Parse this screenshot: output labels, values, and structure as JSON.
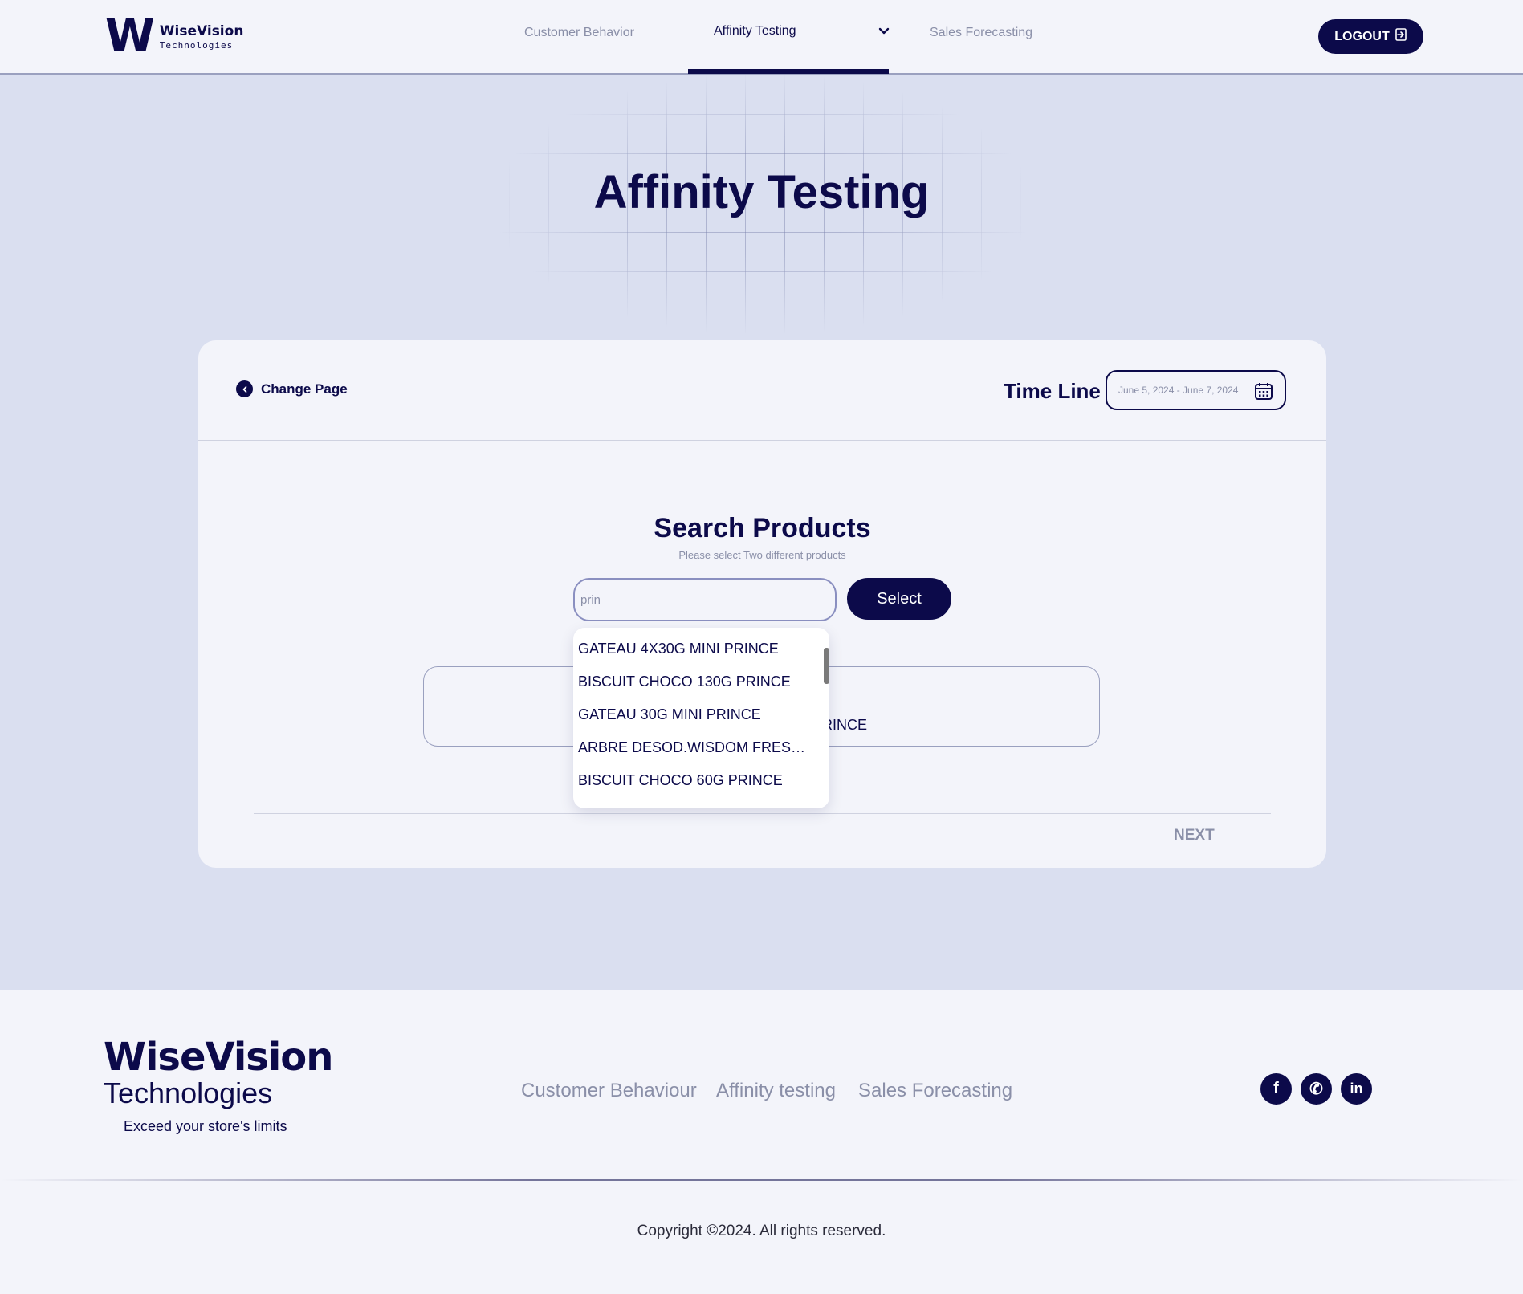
{
  "header": {
    "logo": {
      "mark": "W",
      "name": "WiseVision",
      "sub": "Technologies"
    },
    "nav": [
      {
        "label": "Customer Behavior"
      },
      {
        "label": "Affinity Testing"
      },
      {
        "label": "Sales Forecasting"
      }
    ],
    "logout_label": "LOGOUT"
  },
  "hero": {
    "title": "Affinity Testing"
  },
  "card": {
    "change_page_label": "Change Page",
    "timeline_label": "Time Line",
    "date_range": "June 5, 2024 - June 7, 2024",
    "search_title": "Search Products",
    "search_subtitle": "Please select Two different products",
    "search_value": "prin",
    "select_label": "Select",
    "result_text": "RINCE",
    "next_label": "NEXT"
  },
  "dropdown": {
    "items": [
      "GATEAU 4X30G MINI PRINCE",
      "BISCUIT CHOCO 130G PRINCE",
      "GATEAU 30G MINI PRINCE",
      "ARBRE DESOD.WISDOM FRESH ...",
      "BISCUIT CHOCO 60G PRINCE"
    ]
  },
  "footer": {
    "logo_name": "WiseVision",
    "logo_sub": "Technologies",
    "tagline": "Exceed your store's limits",
    "links": [
      "Customer Behaviour",
      "Affinity testing",
      "Sales Forecasting"
    ],
    "social": [
      {
        "icon": "facebook-icon",
        "glyph": "f"
      },
      {
        "icon": "whatsapp-icon",
        "glyph": "✆"
      },
      {
        "icon": "linkedin-icon",
        "glyph": "in"
      }
    ],
    "copyright": "Copyright ©2024. All rights reserved."
  },
  "colors": {
    "primary": "#0c0a4a",
    "muted": "#8a8fa8",
    "background": "#dadff0",
    "surface": "#f3f4fa"
  }
}
